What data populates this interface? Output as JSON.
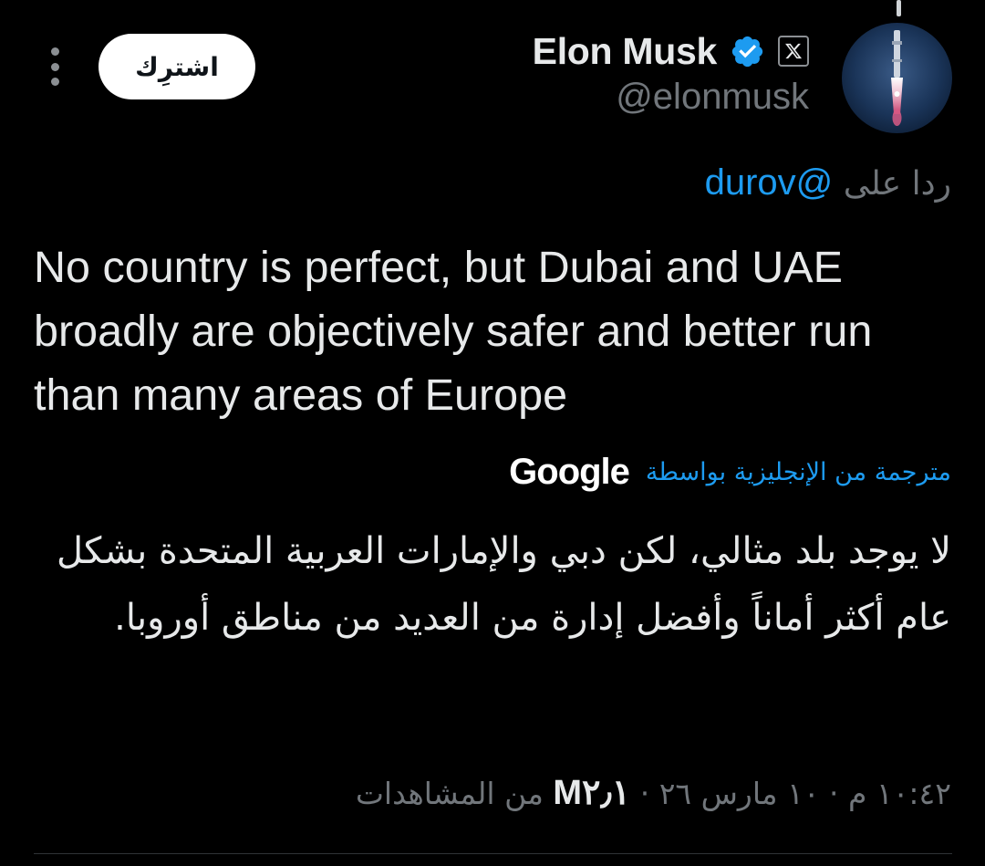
{
  "author": {
    "display_name": "Elon Musk",
    "handle": "@elonmusk"
  },
  "header": {
    "subscribe_label": "اشترِك"
  },
  "reply": {
    "prefix": "ردا على",
    "mention": "@durov"
  },
  "tweet": {
    "text": "No country is perfect, but Dubai and UAE broadly are objectively safer and better run than many areas of Europe"
  },
  "translation": {
    "label": "مترجمة من الإنجليزية بواسطة",
    "provider": "Google",
    "text": "لا يوجد بلد مثالي، لكن دبي والإمارات العربية المتحدة بشكل عام أكثر أماناً وأفضل إدارة من العديد من مناطق أوروبا."
  },
  "meta": {
    "time": "١٠:٤٢ م",
    "date": "١٠ مارس ٢٦",
    "separator": "·",
    "views_count": "M٢٫١",
    "views_label": "من المشاهدات"
  },
  "colors": {
    "background": "#000000",
    "text_primary": "#e7e9ea",
    "text_secondary": "#71767b",
    "accent": "#1d9bf0"
  },
  "icons": {
    "verified": "verified-badge-icon",
    "affiliate": "x-logo-icon",
    "more": "more-vertical-icon"
  }
}
